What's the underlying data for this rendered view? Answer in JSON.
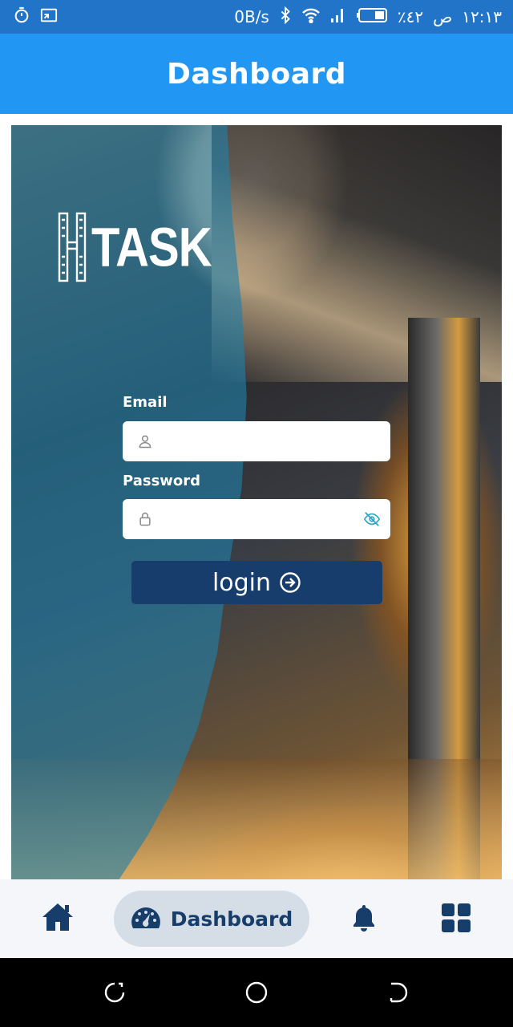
{
  "status_bar": {
    "left_icons": [
      "timer-icon",
      "screen-cast-icon"
    ],
    "net_speed": "0B/s",
    "battery": "٪٤٢",
    "time": "١٢:١٣",
    "period": "ص",
    "right_icons": [
      "bluetooth-icon",
      "wifi-icon",
      "signal-icon",
      "battery-icon"
    ]
  },
  "app_bar": {
    "title": "Dashboard"
  },
  "hero": {
    "logo_text": "TASK"
  },
  "login_form": {
    "email_label": "Email",
    "email_value": "",
    "password_label": "Password",
    "password_value": "",
    "submit_label": "login"
  },
  "bottom_nav": {
    "items": [
      {
        "icon": "home-icon",
        "label": ""
      },
      {
        "icon": "dashboard-gauge-icon",
        "label": "Dashboard",
        "selected": true
      },
      {
        "icon": "bell-icon",
        "label": ""
      },
      {
        "icon": "grid-icon",
        "label": ""
      }
    ]
  },
  "colors": {
    "status_bar": "#2274c9",
    "app_bar": "#2196f3",
    "login_button": "#163d6b",
    "nav_selected_bg": "#d5dde6",
    "nav_icon": "#173e6b"
  }
}
